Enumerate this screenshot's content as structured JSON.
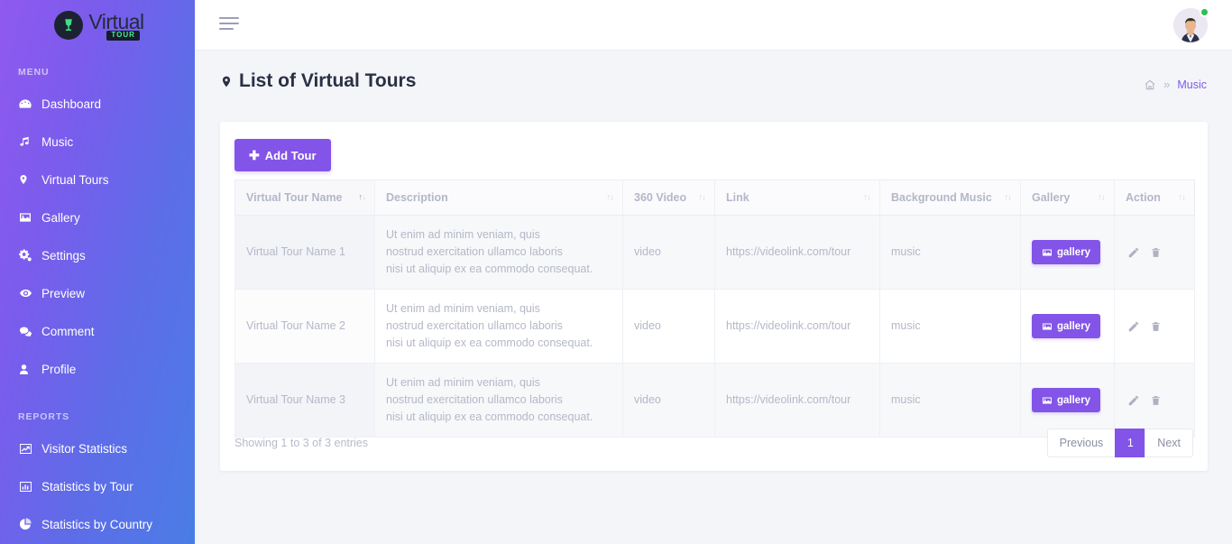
{
  "brand": {
    "word": "Virtual",
    "sub": "tour",
    "badge_icon": "wine-glass-icon"
  },
  "sidebar": {
    "menu_label": "MENU",
    "reports_label": "REPORTS",
    "menu_items": [
      {
        "label": "Dashboard",
        "icon": "dashboard-icon"
      },
      {
        "label": "Music",
        "icon": "music-note-icon"
      },
      {
        "label": "Virtual Tours",
        "icon": "map-pin-icon"
      },
      {
        "label": "Gallery",
        "icon": "image-icon"
      },
      {
        "label": "Settings",
        "icon": "gears-icon"
      },
      {
        "label": "Preview",
        "icon": "eye-icon"
      },
      {
        "label": "Comment",
        "icon": "comment-icon"
      },
      {
        "label": "Profile",
        "icon": "user-icon"
      }
    ],
    "report_items": [
      {
        "label": "Visitor Statistics",
        "icon": "line-chart-icon"
      },
      {
        "label": "Statistics by Tour",
        "icon": "bar-chart-icon"
      },
      {
        "label": "Statistics by Country",
        "icon": "pie-chart-icon"
      }
    ]
  },
  "topbar": {
    "menu_toggle_icon": "hamburger-icon",
    "avatar_icon": "user-avatar",
    "status": "online"
  },
  "page": {
    "title": "List of Virtual Tours",
    "title_icon": "map-pin-icon",
    "breadcrumb": {
      "home_icon": "home-icon",
      "separator": "»",
      "current": "Music"
    }
  },
  "toolbar": {
    "add_tour_label": "Add Tour",
    "add_tour_plus": "➕"
  },
  "table": {
    "columns": [
      {
        "label": "Virtual Tour Name",
        "sorted": "asc"
      },
      {
        "label": "Description",
        "sorted": "none"
      },
      {
        "label": "360 Video",
        "sorted": "none"
      },
      {
        "label": "Link",
        "sorted": "none"
      },
      {
        "label": "Background Music",
        "sorted": "none"
      },
      {
        "label": "Gallery",
        "sorted": "none"
      },
      {
        "label": "Action",
        "sorted": "none"
      }
    ],
    "rows": [
      {
        "name": "Virtual Tour Name 1",
        "description_lines": [
          "Ut enim ad minim veniam, quis",
          "nostrud exercitation ullamco laboris",
          "nisi ut aliquip ex ea commodo consequat."
        ],
        "video": "video",
        "link": "https://videolink.com/tour",
        "music": "music",
        "gallery_label": "gallery",
        "gallery_icon": "image-icon",
        "edit_icon": "pencil-icon",
        "delete_icon": "trash-icon"
      },
      {
        "name": "Virtual Tour Name 2",
        "description_lines": [
          "Ut enim ad minim veniam, quis",
          "nostrud exercitation ullamco laboris",
          "nisi ut aliquip ex ea commodo consequat."
        ],
        "video": "video",
        "link": "https://videolink.com/tour",
        "music": "music",
        "gallery_label": "gallery",
        "gallery_icon": "image-icon",
        "edit_icon": "pencil-icon",
        "delete_icon": "trash-icon"
      },
      {
        "name": "Virtual Tour Name 3",
        "description_lines": [
          "Ut enim ad minim veniam, quis",
          "nostrud exercitation ullamco laboris",
          "nisi ut aliquip ex ea commodo consequat."
        ],
        "video": "video",
        "link": "https://videolink.com/tour",
        "music": "music",
        "gallery_label": "gallery",
        "gallery_icon": "image-icon",
        "edit_icon": "pencil-icon",
        "delete_icon": "trash-icon"
      }
    ]
  },
  "footer": {
    "showing": "Showing 1 to 3 of 3 entries",
    "pagination": [
      {
        "label": "Previous",
        "active": false
      },
      {
        "label": "1",
        "active": true
      },
      {
        "label": "Next",
        "active": false
      }
    ]
  },
  "colors": {
    "accent": "#8354e8",
    "sidebar_from": "#9059ef",
    "sidebar_to": "#4a7de6",
    "status_green": "#2fbe4f",
    "page_bg": "#f4f5f9",
    "breadcrumb_link": "#7f5ce8"
  }
}
